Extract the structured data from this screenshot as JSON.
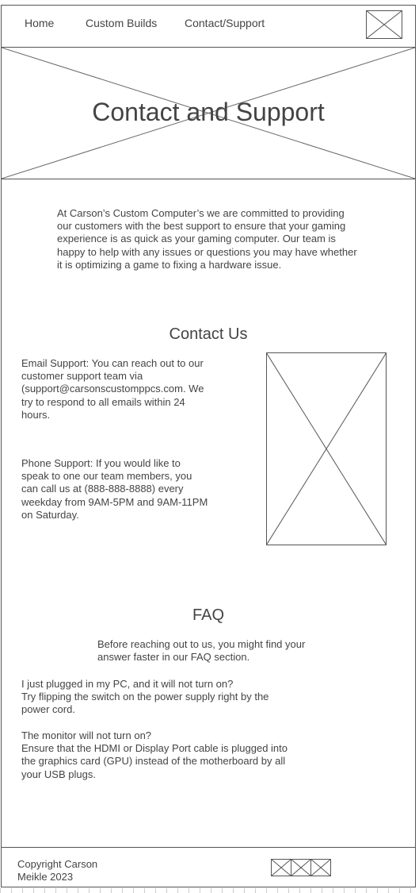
{
  "nav": {
    "items": [
      {
        "label": "Home"
      },
      {
        "label": "Custom Builds"
      },
      {
        "label": "Contact/Support"
      }
    ]
  },
  "hero": {
    "title": "Contact and Support"
  },
  "intro": {
    "text": "At Carson’s Custom Computer’s we are committed to providing our customers with the best support to ensure that your gaming experience is as quick as your gaming computer. Our team is happy to help with any issues or questions you may have whether it is optimizing a game to fixing a hardware issue."
  },
  "contact": {
    "heading": "Contact Us",
    "email_text": "Email Support: You can reach out to our customer support team via (support@carsonscustomppcs.com. We try to respond to all emails within 24 hours.",
    "phone_text": "Phone Support: If you would like to speak to one our team members, you can call us at (888-888-8888) every weekday from 9AM-5PM and 9AM-11PM on Saturday."
  },
  "faq": {
    "heading": "FAQ",
    "intro": "Before reaching out to us, you might find your answer faster in our FAQ section.",
    "items": [
      {
        "question": "I just plugged in my PC, and it will not turn on?",
        "answer": "Try flipping the switch on the power supply right by the power cord."
      },
      {
        "question": "The monitor will not turn on?",
        "answer": "Ensure that the HDMI or Display Port cable is plugged into the graphics card (GPU) instead of the motherboard by all your USB plugs."
      }
    ]
  },
  "footer": {
    "copyright": "Copyright Carson Meikle 2023"
  }
}
